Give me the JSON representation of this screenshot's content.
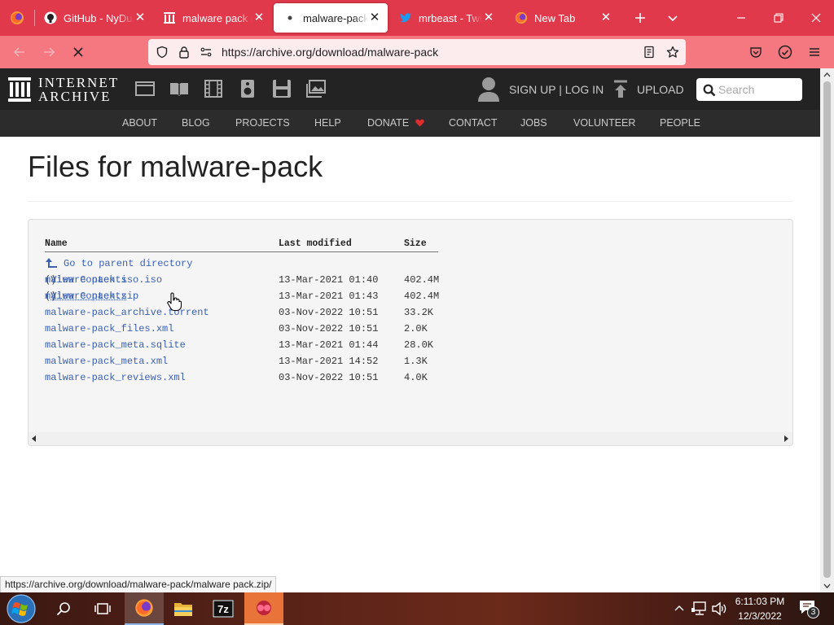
{
  "browser": {
    "tabs": [
      {
        "title": "GitHub - NyDubz"
      },
      {
        "title": "malware pack (c"
      },
      {
        "title": "malware-pack d"
      },
      {
        "title": "mrbeast - Twitter"
      },
      {
        "title": "New Tab"
      }
    ],
    "url": "https://archive.org/download/malware-pack",
    "status_url": "https://archive.org/download/malware-pack/malware pack.zip/"
  },
  "ia": {
    "logo_line1": "INTERNET",
    "logo_line2": "ARCHIVE",
    "signup": "SIGN UP | LOG IN",
    "upload": "UPLOAD",
    "search_placeholder": "Search",
    "menu": [
      "ABOUT",
      "BLOG",
      "PROJECTS",
      "HELP",
      "DONATE",
      "CONTACT",
      "JOBS",
      "VOLUNTEER",
      "PEOPLE"
    ],
    "heart_color": "#e02d2d"
  },
  "page": {
    "title": "Files for malware-pack",
    "columns": [
      "Name",
      "Last modified",
      "Size"
    ],
    "parent_link": "Go to parent directory",
    "view_contents": "View Contents",
    "files": [
      {
        "name": "malware pack iso.iso",
        "view": true,
        "modified": "13-Mar-2021 01:40",
        "size": "402.4M"
      },
      {
        "name": "malware pack.zip",
        "view": true,
        "modified": "13-Mar-2021 01:43",
        "size": "402.4M"
      },
      {
        "name": "malware-pack_archive.torrent",
        "view": false,
        "modified": "03-Nov-2022 10:51",
        "size": "33.2K"
      },
      {
        "name": "malware-pack_files.xml",
        "view": false,
        "modified": "03-Nov-2022 10:51",
        "size": "2.0K"
      },
      {
        "name": "malware-pack_meta.sqlite",
        "view": false,
        "modified": "13-Mar-2021 01:44",
        "size": "28.0K"
      },
      {
        "name": "malware-pack_meta.xml",
        "view": false,
        "modified": "13-Mar-2021 14:52",
        "size": "1.3K"
      },
      {
        "name": "malware-pack_reviews.xml",
        "view": false,
        "modified": "03-Nov-2022 10:51",
        "size": "4.0K"
      }
    ]
  },
  "taskbar": {
    "time": "6:11:03 PM",
    "date": "12/3/2022",
    "notification_count": "3",
    "sevenzip_label": "7z"
  },
  "colors": {
    "tabbar": "#e0394b",
    "navbar": "#f5777f",
    "link": "#3a5fb3",
    "ia_header": "#232323"
  }
}
